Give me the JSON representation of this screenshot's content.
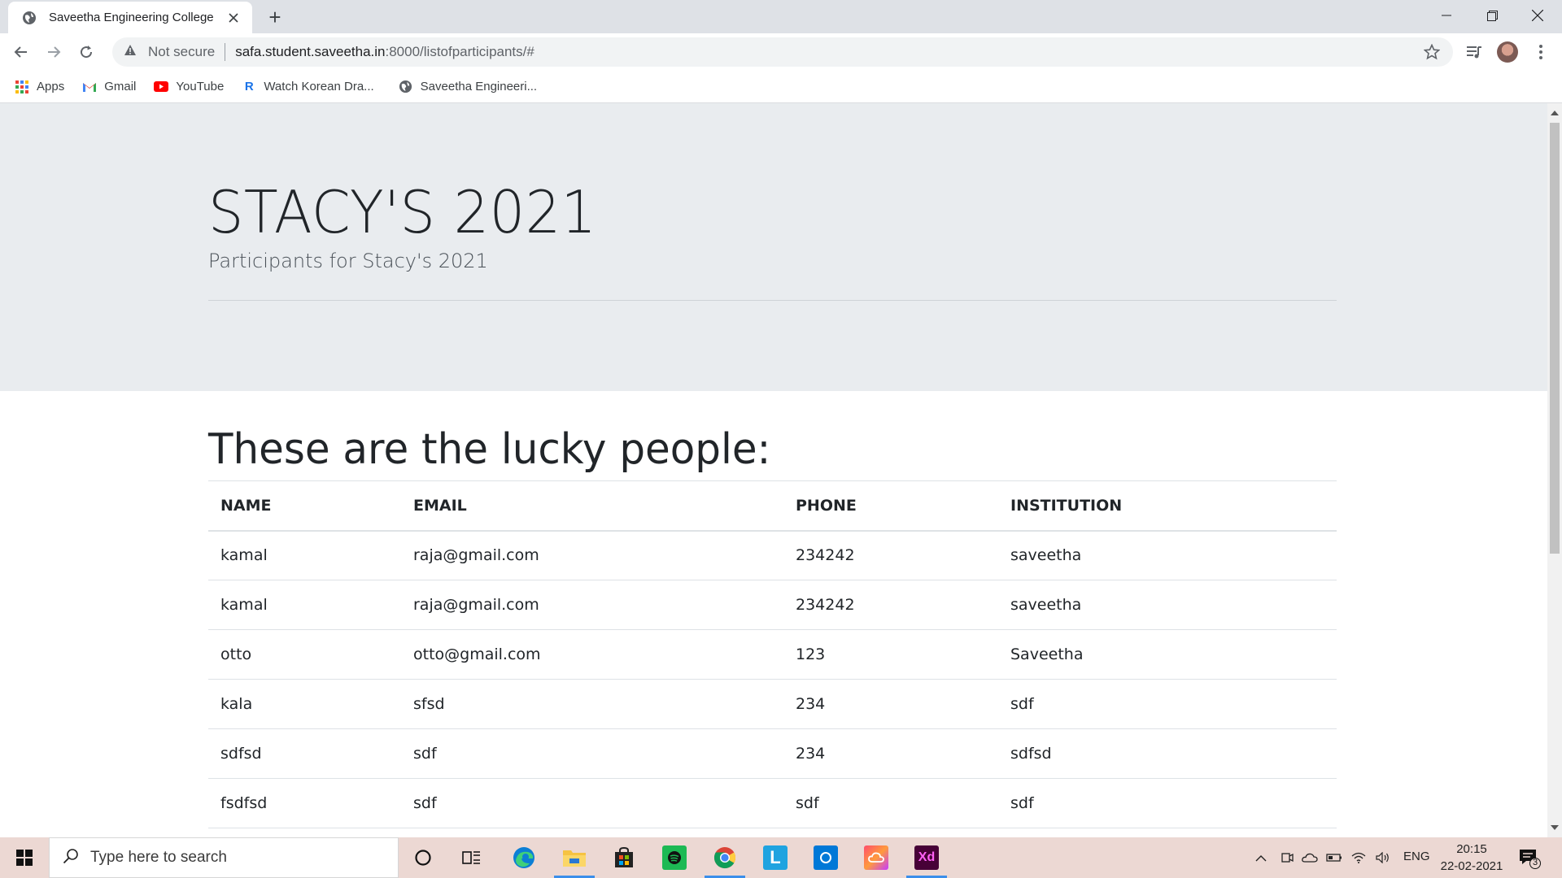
{
  "browser": {
    "tab_title": "Saveetha Engineering College",
    "new_tab": "+",
    "security_label": "Not secure",
    "url_host": "safa.student.saveetha.in",
    "url_path": ":8000/listofparticipants/#",
    "bookmarks": [
      {
        "label": "Apps",
        "icon": "apps-grid-icon"
      },
      {
        "label": "Gmail",
        "icon": "gmail-icon"
      },
      {
        "label": "YouTube",
        "icon": "youtube-icon"
      },
      {
        "label": "Watch Korean Dra...",
        "icon": "r-icon"
      },
      {
        "label": "Saveetha Engineeri...",
        "icon": "globe-icon"
      }
    ]
  },
  "page": {
    "jumbotron_title": "STACY'S 2021",
    "jumbotron_lead": "Participants for Stacy's 2021",
    "section_heading": "These are the lucky people:",
    "table": {
      "headers": [
        "NAME",
        "EMAIL",
        "PHONE",
        "INSTITUTION"
      ],
      "rows": [
        [
          "kamal",
          "raja@gmail.com",
          "234242",
          "saveetha"
        ],
        [
          "kamal",
          "raja@gmail.com",
          "234242",
          "saveetha"
        ],
        [
          "otto",
          "otto@gmail.com",
          "123",
          "Saveetha"
        ],
        [
          "kala",
          "sfsd",
          "234",
          "sdf"
        ],
        [
          "sdfsd",
          "sdf",
          "234",
          "sdfsd"
        ],
        [
          "fsdfsd",
          "sdf",
          "sdf",
          "sdf"
        ]
      ]
    }
  },
  "taskbar": {
    "search_placeholder": "Type here to search",
    "language": "ENG",
    "time": "20:15",
    "date": "22-02-2021",
    "notification_count": "3"
  },
  "colors": {
    "jumbotron_bg": "#e9ecef",
    "tabstrip_bg": "#dee1e6",
    "taskbar_bg": "#ecd8d3",
    "text": "#212529"
  }
}
